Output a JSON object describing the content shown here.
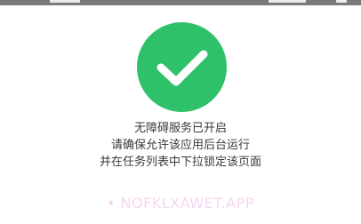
{
  "colors": {
    "status_bar": "#7a7a7a",
    "success_green": "#2fc06a",
    "message_text": "#3a3a3a",
    "watermark": "#f3c9ee"
  },
  "icon": "checkmark-icon",
  "message": {
    "line1": "无障碍服务已开启",
    "line2": "请确保允许该应用后台运行",
    "line3": "并在任务列表中下拉锁定该页面"
  },
  "watermark": {
    "text": "• NOFKLXAWET.APP"
  }
}
